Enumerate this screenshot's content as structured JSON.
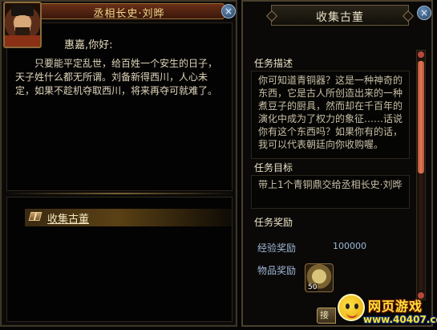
{
  "dialog": {
    "title": "丞相长史·刘晔",
    "greeting": "惠嘉,你好:",
    "speech": "只要能平定乱世，给百姓一个安生的日子，天子姓什么都无所谓。刘备新得西川，人心未定，如果不趁机夺取西川，将来再夺可就难了。",
    "option_label": "收集古董",
    "close_icon": "×"
  },
  "quest": {
    "panel_title": "收集古董",
    "desc_heading": "任务描述",
    "desc_text": "你可知道青铜器？这是一种神奇的东西，它是古人所创造出来的一种煮豆子的厨具，然而却在千百年的演化中成为了权力的象征……话说你有这个东西吗？如果你有的话，我可以代表朝廷向你收购喔。",
    "goal_heading": "任务目标",
    "goal_text": "带上1个青铜鼎交给丞相长史·刘晔",
    "reward_heading": "任务奖励",
    "exp_label": "经验奖励",
    "exp_value": "100000",
    "item_label": "物品奖励",
    "item_count": "50",
    "accept_label": "接",
    "close_icon": "×"
  },
  "watermark": {
    "brand": "网页游戏",
    "url": "www.40407.com"
  },
  "colors": {
    "title_gold": "#f0d88a",
    "reward_blue": "#9fb7d6",
    "scroll_red": "#e2795a"
  }
}
